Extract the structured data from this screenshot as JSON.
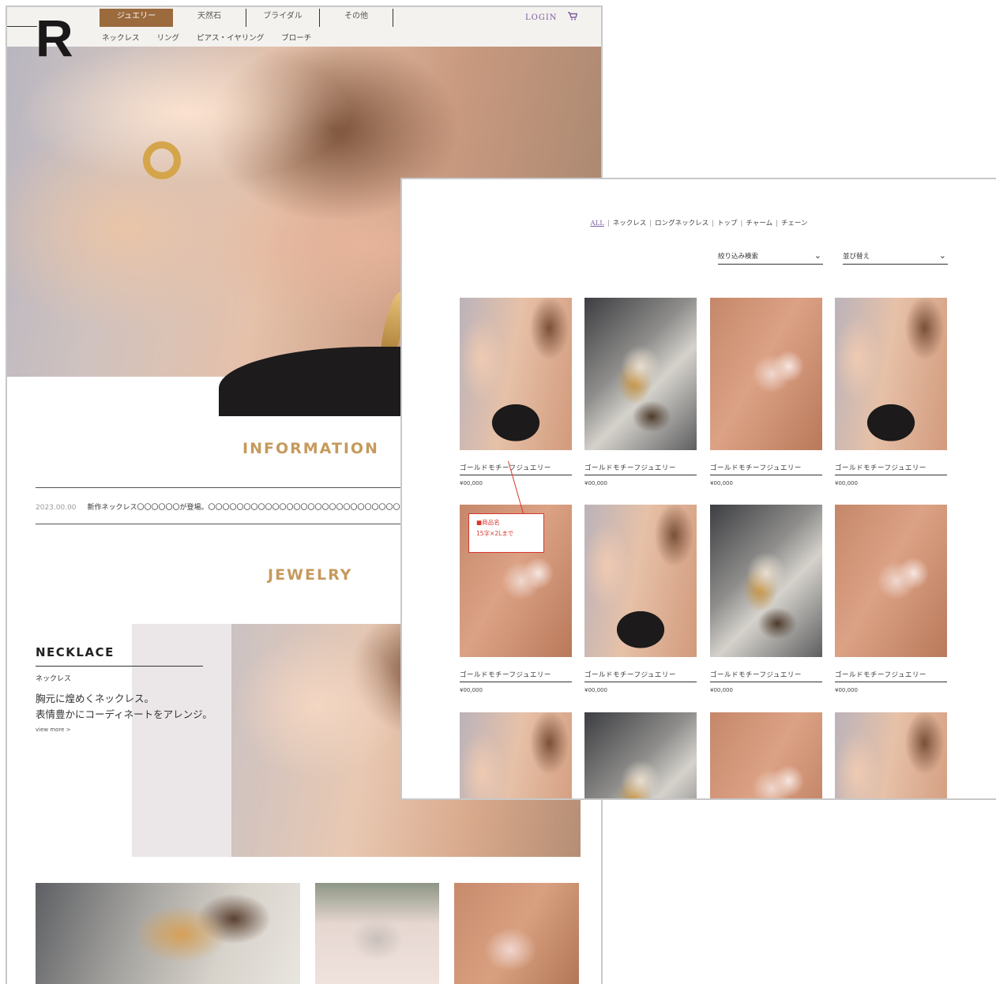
{
  "home": {
    "logo": "R",
    "tabs": [
      "ジュエリー",
      "天然石",
      "ブライダル",
      "その他"
    ],
    "subnav": [
      "ネックレス",
      "リング",
      "ピアス・イヤリング",
      "ブローチ"
    ],
    "login": "LOGIN",
    "cart_icon": "cart-icon",
    "information_title": "INFORMATION",
    "info": {
      "date": "2023.00.00",
      "text": "新作ネックレス〇〇〇〇〇〇が登場。〇〇〇〇〇〇〇〇〇〇〇〇〇〇〇〇〇〇〇〇〇〇〇〇〇〇〇〇〇〇〇〇〇〇"
    },
    "jewelry_title": "JEWELRY",
    "necklace": {
      "title": "NECKLACE",
      "sub": "ネックレス",
      "desc": "胸元に煌めくネックレス。\n表情豊かにコーディネートをアレンジ。",
      "more": "view more >"
    }
  },
  "list": {
    "categories": [
      "ALL",
      "ネックレス",
      "ロングネックレス",
      "トップ",
      "チャーム",
      "チェーン"
    ],
    "filter_label": "絞り込み検索",
    "sort_label": "並び替え",
    "products": [
      {
        "name": "ゴールドモチーフジュエリー",
        "price": "¥00,000"
      },
      {
        "name": "ゴールドモチーフジュエリー",
        "price": "¥00,000"
      },
      {
        "name": "ゴールドモチーフジュエリー",
        "price": "¥00,000"
      },
      {
        "name": "ゴールドモチーフジュエリー",
        "price": "¥00,000"
      },
      {
        "name": "ゴールドモチーフジュエリー",
        "price": "¥00,000"
      },
      {
        "name": "ゴールドモチーフジュエリー",
        "price": "¥00,000"
      },
      {
        "name": "ゴールドモチーフジュエリー",
        "price": "¥00,000"
      },
      {
        "name": "ゴールドモチーフジュエリー",
        "price": "¥00,000"
      }
    ],
    "annotation": "■商品名\n15字×2Lまで"
  },
  "colors": {
    "accent": "#9b6a3d",
    "title_gold": "#c59a5d",
    "link_purple": "#7b5fa0",
    "note_red": "#d9362f"
  }
}
